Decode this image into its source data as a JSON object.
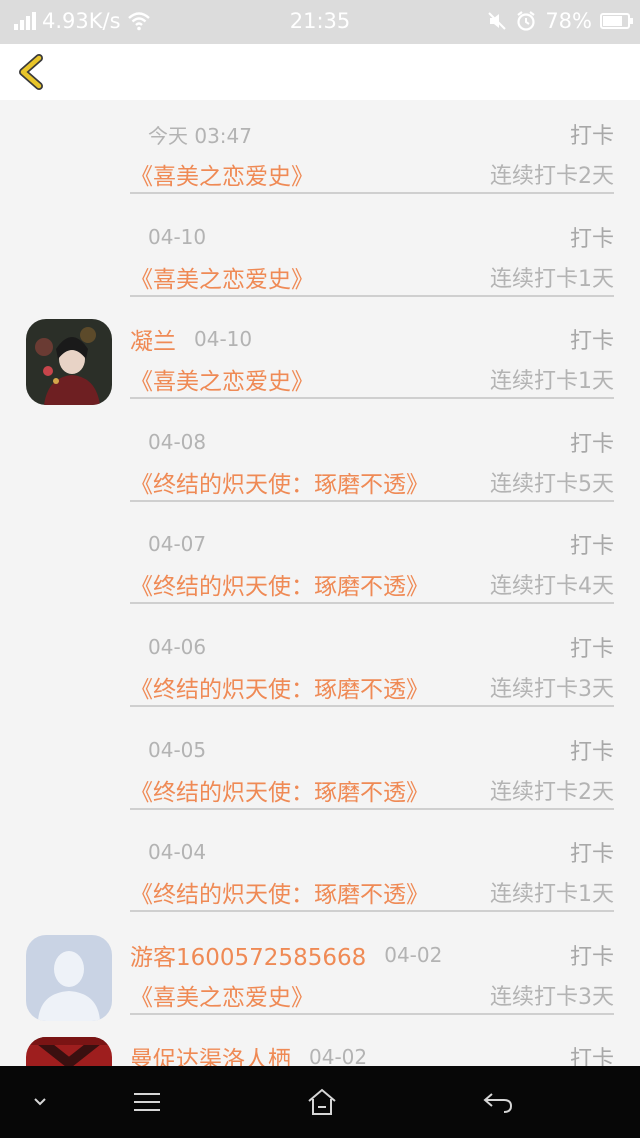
{
  "status_bar": {
    "net_speed": "4.93K/s",
    "time": "21:35",
    "battery": "78%"
  },
  "header": {
    "back_icon": "chevron-left-icon"
  },
  "feed": [
    {
      "user": "",
      "date": "今天 03:47",
      "action": "打卡",
      "book": "《喜美之恋爱史》",
      "streak": "连续打卡2天",
      "avatar": "none"
    },
    {
      "user": "",
      "date": "04-10",
      "action": "打卡",
      "book": "《喜美之恋爱史》",
      "streak": "连续打卡1天",
      "avatar": "none"
    },
    {
      "user": "凝兰",
      "date": "04-10",
      "action": "打卡",
      "book": "《喜美之恋爱史》",
      "streak": "连续打卡1天",
      "avatar": "portrait"
    },
    {
      "user": "",
      "date": "04-08",
      "action": "打卡",
      "book": "《终结的炽天使：琢磨不透》",
      "streak": "连续打卡5天",
      "avatar": "none"
    },
    {
      "user": "",
      "date": "04-07",
      "action": "打卡",
      "book": "《终结的炽天使：琢磨不透》",
      "streak": "连续打卡4天",
      "avatar": "none"
    },
    {
      "user": "",
      "date": "04-06",
      "action": "打卡",
      "book": "《终结的炽天使：琢磨不透》",
      "streak": "连续打卡3天",
      "avatar": "none"
    },
    {
      "user": "",
      "date": "04-05",
      "action": "打卡",
      "book": "《终结的炽天使：琢磨不透》",
      "streak": "连续打卡2天",
      "avatar": "none"
    },
    {
      "user": "",
      "date": "04-04",
      "action": "打卡",
      "book": "《终结的炽天使：琢磨不透》",
      "streak": "连续打卡1天",
      "avatar": "none"
    },
    {
      "user": "游客1600572585668",
      "date": "04-02",
      "action": "打卡",
      "book": "《喜美之恋爱史》",
      "streak": "连续打卡3天",
      "avatar": "default"
    },
    {
      "user": "曼促达渠洛人栖",
      "date": "04-02",
      "action": "打卡",
      "book": "",
      "streak": "",
      "avatar": "red"
    }
  ],
  "colors": {
    "accent": "#ef8a55",
    "muted": "#b3b3b3",
    "back_icon": "#e8c52a"
  },
  "nav_bar": {
    "icons": [
      "chevron-down-icon",
      "menu-icon",
      "home-icon",
      "back-arrow-icon"
    ]
  }
}
